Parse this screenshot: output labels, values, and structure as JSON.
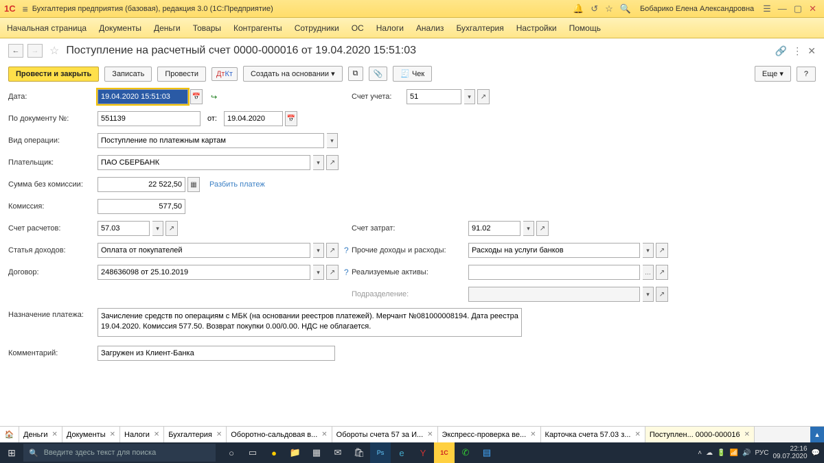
{
  "titlebar": {
    "logo": "1С",
    "title": "Бухгалтерия предприятия (базовая), редакция 3.0  (1С:Предприятие)",
    "user": "Бобарико Елена Александровна"
  },
  "menubar": [
    "Начальная страница",
    "Документы",
    "Деньги",
    "Товары",
    "Контрагенты",
    "Сотрудники",
    "ОС",
    "Налоги",
    "Анализ",
    "Бухгалтерия",
    "Настройки",
    "Помощь"
  ],
  "doc": {
    "title": "Поступление на расчетный счет 0000-000016 от 19.04.2020 15:51:03"
  },
  "toolbar": {
    "post_close": "Провести и закрыть",
    "write": "Записать",
    "post": "Провести",
    "dtkt": "Дт Кт",
    "create_based": "Создать на основании",
    "check": "Чек",
    "more": "Еще",
    "help": "?"
  },
  "labels": {
    "date": "Дата:",
    "account": "Счет учета:",
    "docnum": "По документу №:",
    "from": "от:",
    "optype": "Вид операции:",
    "payer": "Плательщик:",
    "sum_no_comm": "Сумма без комиссии:",
    "split": "Разбить платеж",
    "commission": "Комиссия:",
    "calc_account": "Счет расчетов:",
    "cost_account": "Счет затрат:",
    "income_item": "Статья доходов:",
    "other_inc_exp": "Прочие доходы и расходы:",
    "contract": "Договор:",
    "realized_assets": "Реализуемые активы:",
    "division": "Подразделение:",
    "purpose": "Назначение платежа:",
    "comment": "Комментарий:"
  },
  "values": {
    "date": "19.04.2020 15:51:03",
    "account": "51",
    "docnum": "551139",
    "from_date": "19.04.2020",
    "optype": "Поступление по платежным картам",
    "payer": "ПАО СБЕРБАНК",
    "sum_no_comm": "22 522,50",
    "commission": "577,50",
    "calc_account": "57.03",
    "cost_account": "91.02",
    "income_item": "Оплата от покупателей",
    "other_inc_exp": "Расходы на услуги банков",
    "contract": "248636098 от 25.10.2019",
    "realized_assets": "",
    "division": "",
    "purpose": "Зачисление средств по операциям с МБК (на основании реестров платежей). Мерчант №081000008194. Дата реестра 19.04.2020. Комиссия 577.50. Возврат покупки 0.00/0.00. НДС не облагается.",
    "comment": "Загружен из Клиент-Банка"
  },
  "tabs": [
    "Деньги",
    "Документы",
    "Налоги",
    "Бухгалтерия",
    "Оборотно-сальдовая в...",
    "Обороты счета 57 за И...",
    "Экспресс-проверка ве...",
    "Карточка счета 57.03 з...",
    "Поступлен... 0000-000016"
  ],
  "taskbar": {
    "search_placeholder": "Введите здесь текст для поиска",
    "time": "22:16",
    "date": "09.07.2020",
    "lang": "РУС"
  }
}
